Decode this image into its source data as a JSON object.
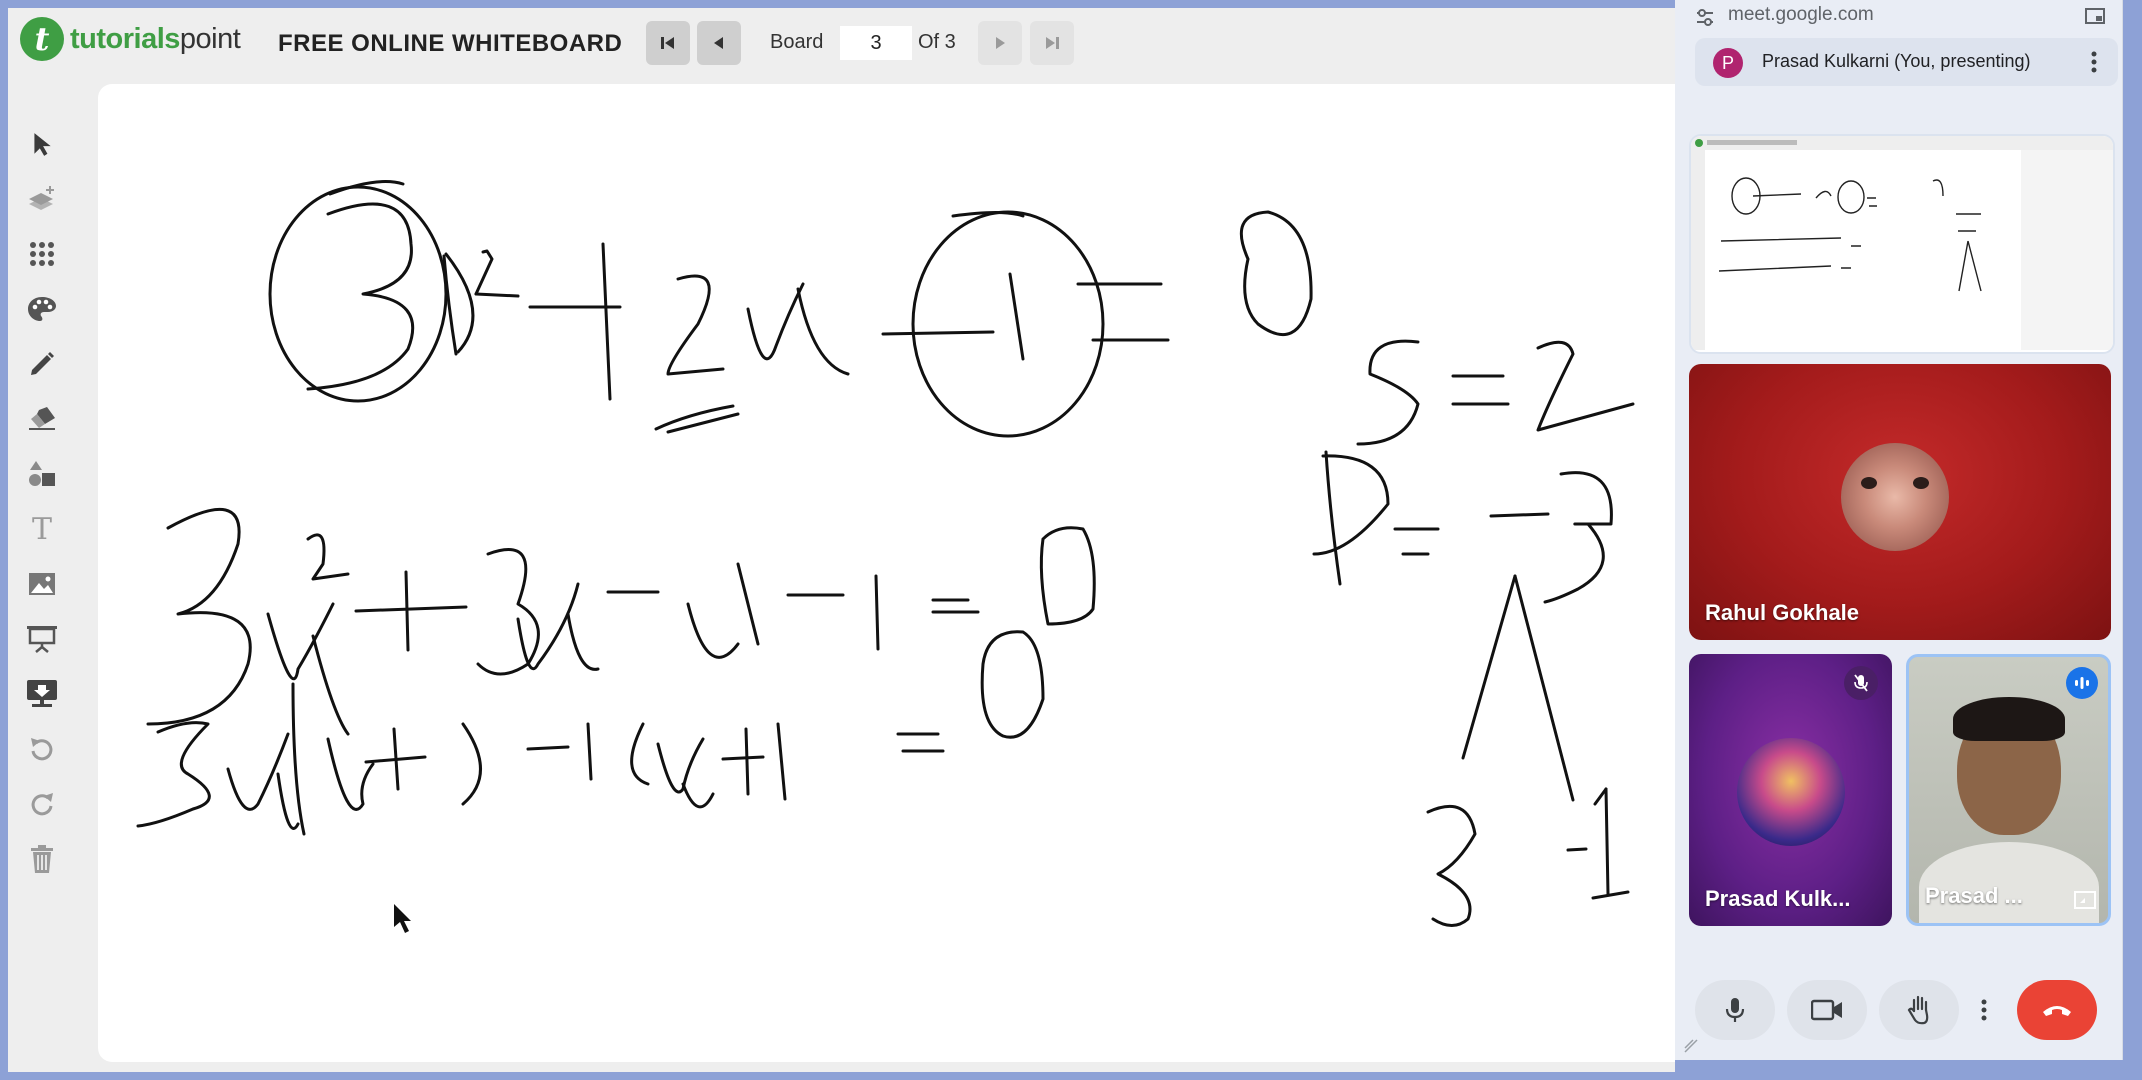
{
  "logo": {
    "brand_green": "tutorials",
    "brand_dark": "point",
    "mark": "t"
  },
  "app": {
    "title": "FREE ONLINE WHITEBOARD"
  },
  "board": {
    "label": "Board",
    "current": "3",
    "of": "Of 3"
  },
  "toolbar": {
    "tools": [
      "select-icon",
      "layers-icon",
      "dots-grid-icon",
      "palette-icon",
      "pencil-icon",
      "eraser-icon",
      "shapes-icon",
      "text-icon",
      "image-icon",
      "presentation-icon",
      "download-icon",
      "undo-icon",
      "redo-icon",
      "trash-icon"
    ],
    "text_tool_glyph": "T"
  },
  "meet": {
    "url": "meet.google.com",
    "presenter_initial": "P",
    "presenter_name": "Prasad Kulkarni (You, presenting)",
    "participants": [
      {
        "name": "Rahul Gokhale"
      },
      {
        "name": "Prasad Kulk..."
      },
      {
        "name": "Prasad ..."
      }
    ],
    "controls": [
      "mic-icon",
      "camera-icon",
      "raise-hand-icon",
      "more-icon",
      "end-call-icon"
    ],
    "colors": {
      "end_call": "#ea4335",
      "presenter_avatar": "#b0246f"
    }
  },
  "colors": {
    "brand": "#3f9e44",
    "page_bg": "#8da1d6"
  }
}
